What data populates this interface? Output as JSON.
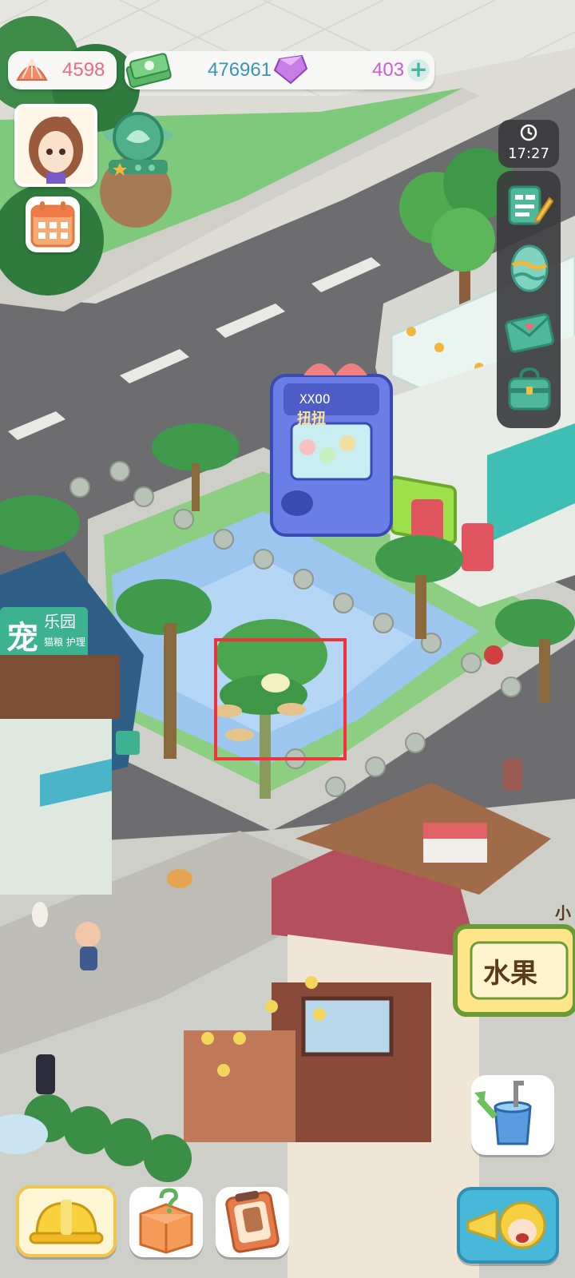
{
  "hud": {
    "shells": "4598",
    "cash": "476961",
    "gems": "403",
    "add_symbol": "+",
    "clock_time": "17:27"
  },
  "scene": {
    "pet_shop_sign_big": "宠",
    "pet_shop_sign_title": "乐园",
    "pet_shop_sign_sub": "猫粮 护理",
    "gacha_top": "XXOO",
    "gacha_label": "扭扭",
    "fruit_sign": "水果",
    "fruit_sign_small": "小"
  },
  "colors": {
    "shell_text": "#e96a8d",
    "cash_text": "#3a93b8",
    "gem_text": "#c85fd0",
    "highlight": "#f0333b",
    "road": "#6e6e71",
    "grass": "#7ecf7f"
  },
  "icons": {
    "side": [
      "notes-pencil-icon",
      "easter-egg-icon",
      "mail-envelope-icon",
      "bag-icon"
    ],
    "bottom": [
      "hard-hat-icon",
      "mystery-box-icon",
      "drink-card-icon",
      "watering-can-icon",
      "megaphone-character-icon"
    ]
  }
}
